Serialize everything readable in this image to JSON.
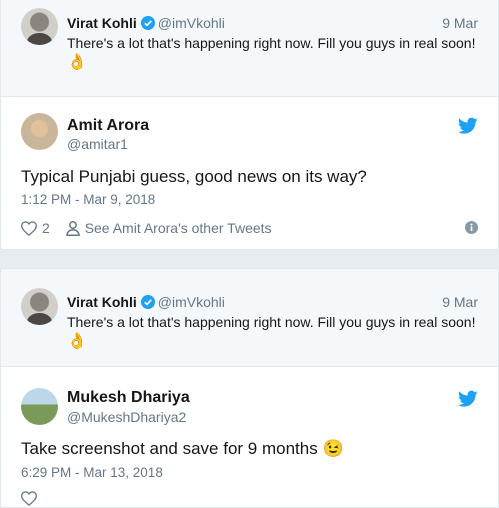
{
  "threads": [
    {
      "quoted": {
        "name": "Virat Kohli",
        "handle": "@imVkohli",
        "date": "9 Mar",
        "text": "There's a lot that's happening right now. Fill you guys in real soon!",
        "emoji": "👌"
      },
      "reply": {
        "name": "Amit Arora",
        "handle": "@amitar1",
        "text": "Typical Punjabi guess, good news on its way?",
        "timestamp": "1:12 PM - Mar 9, 2018",
        "likes": "2",
        "profile_link": "See Amit Arora's other Tweets"
      }
    },
    {
      "quoted": {
        "name": "Virat Kohli",
        "handle": "@imVkohli",
        "date": "9 Mar",
        "text": "There's a lot that's happening right now. Fill you guys in real soon!",
        "emoji": "👌"
      },
      "reply": {
        "name": "Mukesh Dhariya",
        "handle": "@MukeshDhariya2",
        "text": "Take screenshot and save for 9 months 😉",
        "timestamp": "6:29 PM - Mar 13, 2018"
      }
    }
  ],
  "colors": {
    "twitter_blue": "#1da1f2",
    "muted": "#657786",
    "border": "#e1e8ed"
  },
  "icons": [
    "verified-icon",
    "twitter-bird-icon",
    "heart-icon",
    "person-icon",
    "info-icon"
  ]
}
